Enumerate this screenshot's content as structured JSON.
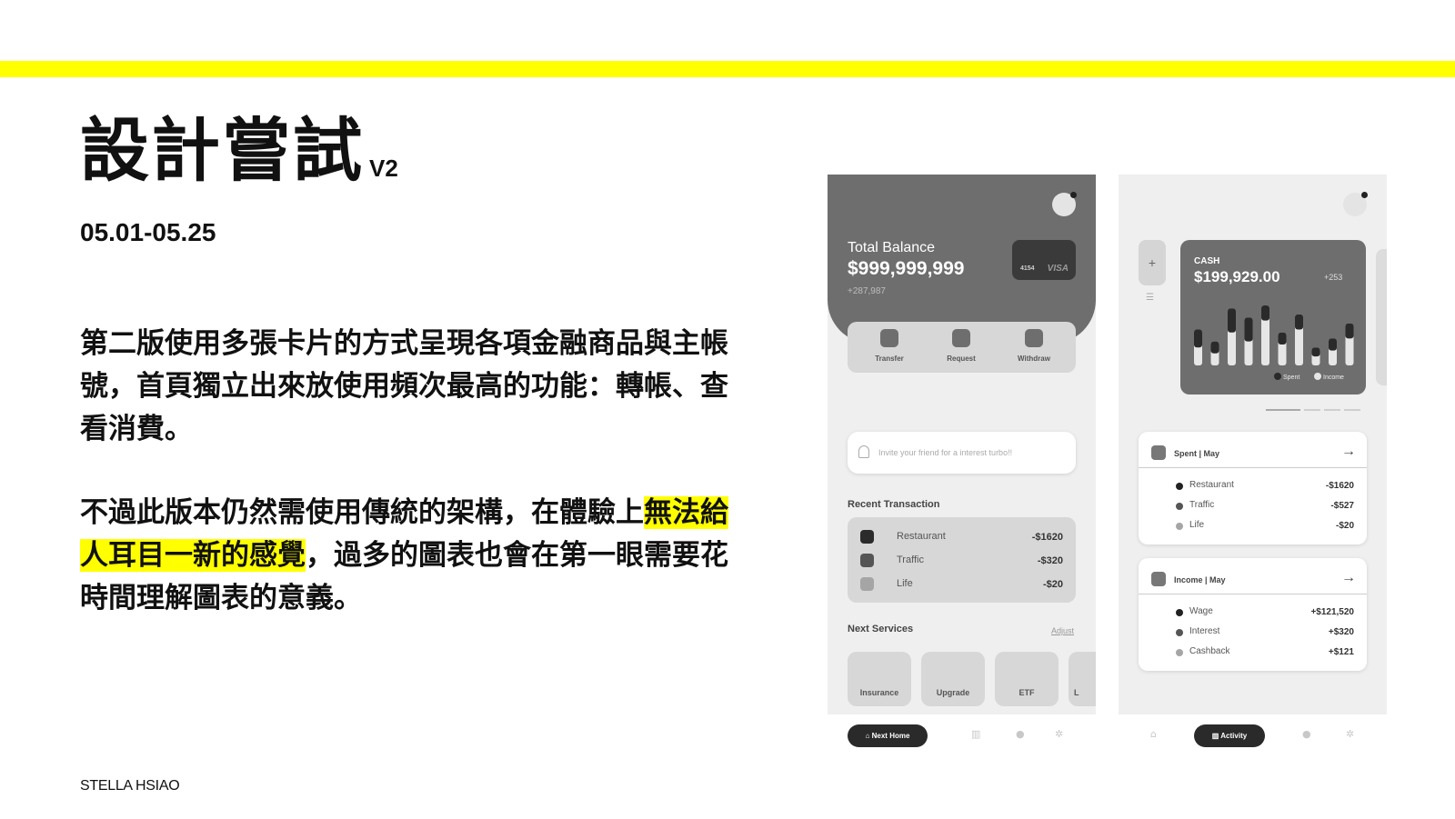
{
  "slide": {
    "title": "設計嘗試",
    "version": "V2",
    "date_range": "05.01-05.25",
    "para1": "第二版使用多張卡片的方式呈現各項金融商品與主帳號，首頁獨立出來放使用頻次最高的功能：轉帳、查看消費。",
    "para2_a": "不過此版本仍然需使用傳統的架構，在體驗上",
    "para2_highlight": "無法給人耳目一新的感覺",
    "para2_b": "，過多的圖表也會在第一眼需要花時間理解圖表的意義。",
    "author": "STELLA HSIAO",
    "highlight_color": "#ffff00"
  },
  "home": {
    "balance_label": "Total Balance",
    "balance_amount": "$999,999,999",
    "balance_delta": "+287,987",
    "card_number": "4154",
    "card_brand": "VISA",
    "actions": [
      "Transfer",
      "Request",
      "Withdraw"
    ],
    "invite_text": "Invite your friend for a interest turbo!!",
    "recent_title": "Recent Transaction",
    "transactions": [
      {
        "name": "Restaurant",
        "amount": "-$1620",
        "color": "#2b2b2b"
      },
      {
        "name": "Traffic",
        "amount": "-$320",
        "color": "#555555"
      },
      {
        "name": "Life",
        "amount": "-$20",
        "color": "#a5a5a5"
      }
    ],
    "services_title": "Next Services",
    "services_adjust": "Adjust",
    "services": [
      "Insurance",
      "Upgrade",
      "ETF",
      "L"
    ],
    "nav_active": "Next Home"
  },
  "activity": {
    "cash_label": "CASH",
    "cash_amount": "$199,929.00",
    "cash_delta": "+253",
    "legend": [
      "Spent",
      "Income"
    ],
    "spent_title": "Spent | May",
    "spent_rows": [
      {
        "name": "Restaurant",
        "amount": "-$1620",
        "color": "#222222"
      },
      {
        "name": "Traffic",
        "amount": "-$527",
        "color": "#555555"
      },
      {
        "name": "Life",
        "amount": "-$20",
        "color": "#a5a5a5"
      }
    ],
    "income_title": "Income | May",
    "income_rows": [
      {
        "name": "Wage",
        "amount": "+$121,520",
        "color": "#222222"
      },
      {
        "name": "Interest",
        "amount": "+$320",
        "color": "#555555"
      },
      {
        "name": "Cashback",
        "amount": "+$121",
        "color": "#a5a5a5"
      }
    ],
    "nav_active": "Activity",
    "bars": [
      {
        "spent": 0.45,
        "income": 0.6
      },
      {
        "spent": 0.35,
        "income": 0.4
      },
      {
        "spent": 0.7,
        "income": 0.95
      },
      {
        "spent": 0.55,
        "income": 0.8
      },
      {
        "spent": 0.9,
        "income": 1.0
      },
      {
        "spent": 0.5,
        "income": 0.55
      },
      {
        "spent": 0.75,
        "income": 0.85
      },
      {
        "spent": 0.25,
        "income": 0.3
      },
      {
        "spent": 0.4,
        "income": 0.45
      },
      {
        "spent": 0.6,
        "income": 0.7
      }
    ]
  }
}
